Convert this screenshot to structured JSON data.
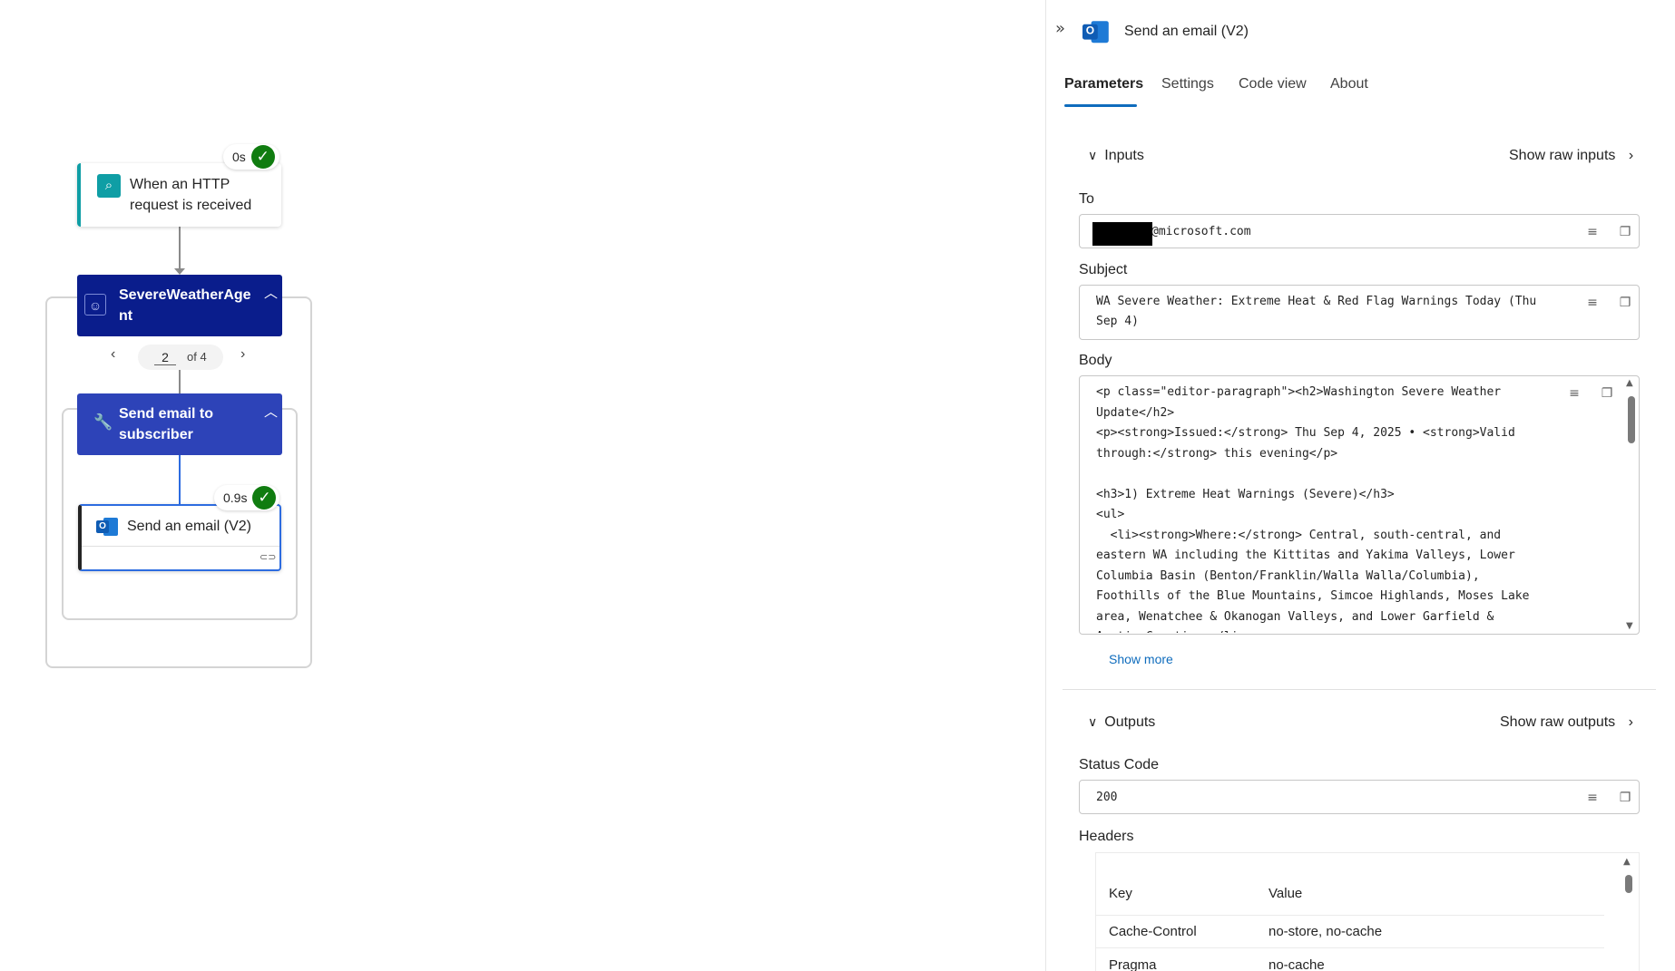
{
  "canvas": {
    "trigger": {
      "title": "When an HTTP request is received",
      "duration": "0s"
    },
    "agent": {
      "title": "SevereWeatherAgent",
      "title_line1": "SevereWeatherAge",
      "title_line2": "nt"
    },
    "pager": {
      "current": "2",
      "of_label": "of 4"
    },
    "subscope": {
      "title_line1": "Send email to",
      "title_line2": "subscriber"
    },
    "action": {
      "title": "Send an email (V2)",
      "duration": "0.9s"
    }
  },
  "panel": {
    "title": "Send an email (V2)",
    "tabs": [
      {
        "label": "Parameters",
        "active": true
      },
      {
        "label": "Settings"
      },
      {
        "label": "Code view"
      },
      {
        "label": "About"
      }
    ],
    "inputs": {
      "heading": "Inputs",
      "show_raw": "Show raw inputs",
      "to_label": "To",
      "to_value": "@microsoft.com",
      "subject_label": "Subject",
      "subject_lines": [
        "WA Severe Weather: Extreme Heat & Red Flag Warnings Today (Thu",
        "Sep 4)"
      ],
      "body_label": "Body",
      "body_lines": [
        "<p class=\"editor-paragraph\"><h2>Washington Severe Weather",
        "Update</h2>",
        "<p><strong>Issued:</strong> Thu Sep 4, 2025 • <strong>Valid",
        "through:</strong> this evening</p>",
        "",
        "<h3>1) Extreme Heat Warnings (Severe)</h3>",
        "<ul>",
        "  <li><strong>Where:</strong> Central, south-central, and",
        "eastern WA including the Kittitas and Yakima Valleys, Lower",
        "Columbia Basin (Benton/Franklin/Walla Walla/Columbia),",
        "Foothills of the Blue Mountains, Simcoe Highlands, Moses Lake",
        "area, Wenatchee & Okanogan Valleys, and Lower Garfield &",
        "Asotin Counties.</li>"
      ],
      "show_more": "Show more"
    },
    "outputs": {
      "heading": "Outputs",
      "show_raw": "Show raw outputs",
      "status_label": "Status Code",
      "status_value": "200",
      "headers_label": "Headers",
      "headers_columns": [
        "Key",
        "Value"
      ],
      "headers_rows": [
        {
          "key": "Cache-Control",
          "value": "no-store, no-cache"
        },
        {
          "key": "Pragma",
          "value": "no-cache"
        }
      ]
    }
  },
  "colors": {
    "accent": "#0f6cbd",
    "agent": "#0a1d8c",
    "scope": "#2d43b8",
    "trigger": "#0f9ea5",
    "success": "#107c10"
  }
}
